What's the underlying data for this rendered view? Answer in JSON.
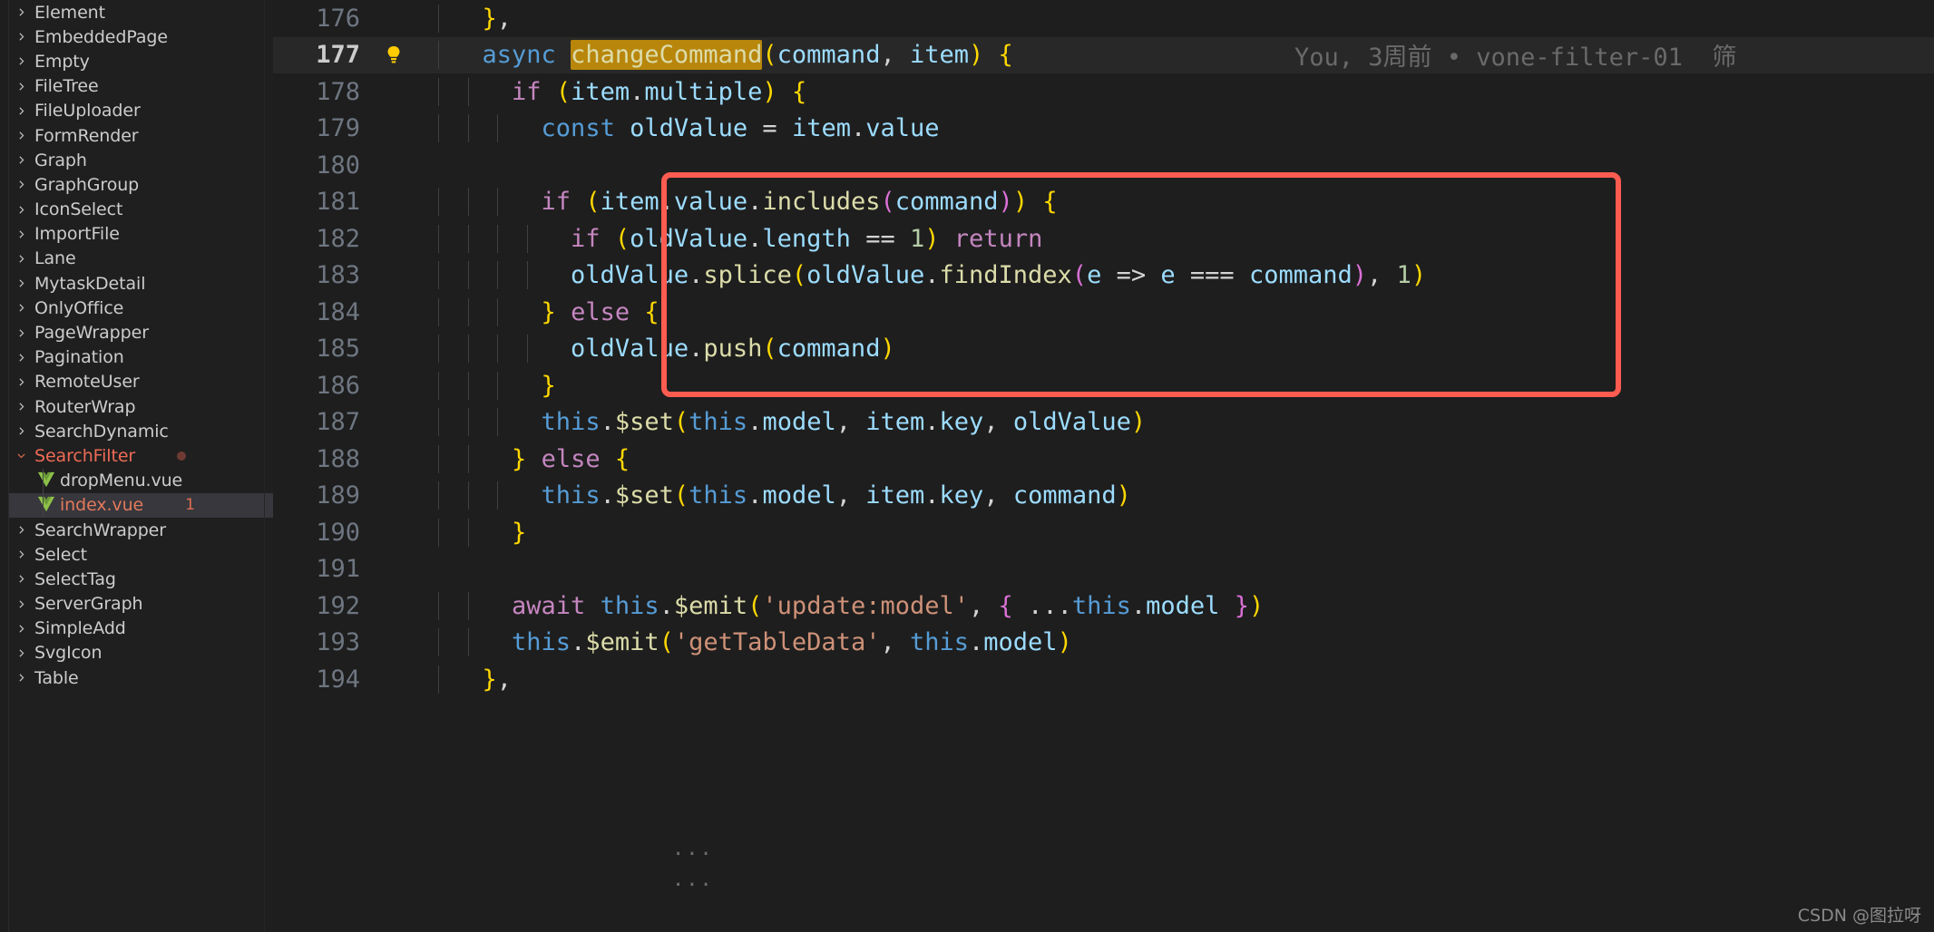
{
  "sidebar": {
    "items": [
      {
        "label": "Element",
        "type": "folder",
        "expanded": false
      },
      {
        "label": "EmbeddedPage",
        "type": "folder",
        "expanded": false
      },
      {
        "label": "Empty",
        "type": "folder",
        "expanded": false
      },
      {
        "label": "FileTree",
        "type": "folder",
        "expanded": false
      },
      {
        "label": "FileUploader",
        "type": "folder",
        "expanded": false
      },
      {
        "label": "FormRender",
        "type": "folder",
        "expanded": false
      },
      {
        "label": "Graph",
        "type": "folder",
        "expanded": false
      },
      {
        "label": "GraphGroup",
        "type": "folder",
        "expanded": false
      },
      {
        "label": "IconSelect",
        "type": "folder",
        "expanded": false
      },
      {
        "label": "ImportFile",
        "type": "folder",
        "expanded": false
      },
      {
        "label": "Lane",
        "type": "folder",
        "expanded": false
      },
      {
        "label": "MytaskDetail",
        "type": "folder",
        "expanded": false
      },
      {
        "label": "OnlyOffice",
        "type": "folder",
        "expanded": false
      },
      {
        "label": "PageWrapper",
        "type": "folder",
        "expanded": false
      },
      {
        "label": "Pagination",
        "type": "folder",
        "expanded": false
      },
      {
        "label": "RemoteUser",
        "type": "folder",
        "expanded": false
      },
      {
        "label": "RouterWrap",
        "type": "folder",
        "expanded": false
      },
      {
        "label": "SearchDynamic",
        "type": "folder",
        "expanded": false
      },
      {
        "label": "SearchFilter",
        "type": "folder",
        "expanded": true,
        "status": "modified",
        "badge": "dot"
      },
      {
        "label": "dropMenu.vue",
        "type": "file",
        "icon": "vue-icon"
      },
      {
        "label": "index.vue",
        "type": "file",
        "icon": "vue-icon",
        "status": "modified",
        "selected": true,
        "badge": "1"
      },
      {
        "label": "SearchWrapper",
        "type": "folder",
        "expanded": false
      },
      {
        "label": "Select",
        "type": "folder",
        "expanded": false
      },
      {
        "label": "SelectTag",
        "type": "folder",
        "expanded": false
      },
      {
        "label": "ServerGraph",
        "type": "folder",
        "expanded": false
      },
      {
        "label": "SimpleAdd",
        "type": "folder",
        "expanded": false
      },
      {
        "label": "SvgIcon",
        "type": "folder",
        "expanded": false
      },
      {
        "label": "Table",
        "type": "folder",
        "expanded": false
      }
    ]
  },
  "editor": {
    "active_line": 177,
    "selection_text": "changeCommand",
    "blame": "You, 3周前 • vone-filter-01  筛",
    "line_numbers": [
      176,
      177,
      178,
      179,
      180,
      181,
      182,
      183,
      184,
      185,
      186,
      187,
      188,
      189,
      190,
      191,
      192,
      193,
      194
    ],
    "lines": [
      {
        "n": "176",
        "code": "  },",
        "active": false
      },
      {
        "n": "177",
        "code": "  async changeCommand(command, item) {",
        "active": true
      },
      {
        "n": "178",
        "code": "    if (item.multiple) {",
        "active": false
      },
      {
        "n": "179",
        "code": "      const oldValue = item.value",
        "active": false
      },
      {
        "n": "180",
        "code": "",
        "active": false
      },
      {
        "n": "181",
        "code": "      if (item.value.includes(command)) {",
        "active": false
      },
      {
        "n": "182",
        "code": "        if (oldValue.length == 1) return",
        "active": false
      },
      {
        "n": "183",
        "code": "        oldValue.splice(oldValue.findIndex(e => e === command), 1)",
        "active": false
      },
      {
        "n": "184",
        "code": "      } else {",
        "active": false
      },
      {
        "n": "185",
        "code": "        oldValue.push(command)",
        "active": false
      },
      {
        "n": "186",
        "code": "      }",
        "active": false
      },
      {
        "n": "187",
        "code": "      this.$set(this.model, item.key, oldValue)",
        "active": false
      },
      {
        "n": "188",
        "code": "    } else {",
        "active": false
      },
      {
        "n": "189",
        "code": "      this.$set(this.model, item.key, command)",
        "active": false
      },
      {
        "n": "190",
        "code": "    }",
        "active": false
      },
      {
        "n": "191",
        "code": "",
        "active": false
      },
      {
        "n": "192",
        "code": "    await this.$emit('update:model', { ...this.model })",
        "active": false
      },
      {
        "n": "193",
        "code": "    this.$emit('getTableData', this.model)",
        "active": false
      },
      {
        "n": "194",
        "code": "  },",
        "active": false
      }
    ],
    "annotation": {
      "type": "red-rectangle",
      "color": "#ff5c51",
      "covers_lines": [
        181,
        182,
        183,
        184,
        185,
        186
      ]
    }
  },
  "watermark": {
    "text": "CSDN @图拉呀"
  },
  "colors": {
    "background": "#1e1e1e",
    "sidebar_bg": "#1f1f1f",
    "selection_highlight": "#b8860b",
    "annotation_red": "#ff5c51",
    "modified_file": "#e06c53",
    "active_line_bg": "#282828"
  }
}
